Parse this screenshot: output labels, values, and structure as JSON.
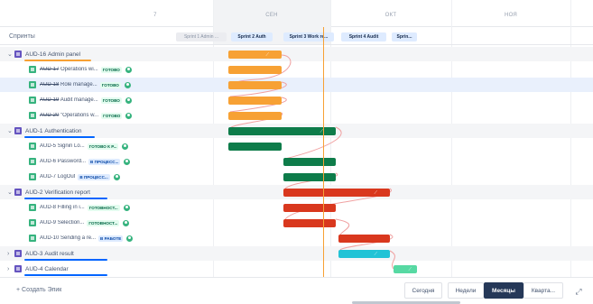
{
  "timeline": {
    "months": [
      "СЕН",
      "ОКТ",
      "НОЯ"
    ],
    "partial_label": "7",
    "sprints_label": "Спринты",
    "sprints": [
      {
        "label": "Sprint 1 Admin ...",
        "past": true
      },
      {
        "label": "Sprint 2 Auth",
        "past": false
      },
      {
        "label": "Sprint 3 Work re...",
        "past": false
      },
      {
        "label": "Sprint 4 Audit",
        "past": false
      },
      {
        "label": "Sprin...",
        "past": false
      }
    ]
  },
  "rows": [
    {
      "type": "epic",
      "key": "AUD-16",
      "title": "Admin panel",
      "expanded": true,
      "underline_color": "#f7a134"
    },
    {
      "type": "story",
      "key": "AUD-17",
      "title": "Operations wi...",
      "status": "ГОТОВО",
      "status_kind": "done",
      "struck": true
    },
    {
      "type": "story",
      "key": "AUD-18",
      "title": "Role manage...",
      "status": "ГОТОВО",
      "status_kind": "done",
      "struck": true,
      "selected": true
    },
    {
      "type": "story",
      "key": "AUD-19",
      "title": "Audit manage...",
      "status": "ГОТОВО",
      "status_kind": "done",
      "struck": true
    },
    {
      "type": "story",
      "key": "AUD-20",
      "title": "\"Operations w...",
      "status": "ГОТОВО",
      "status_kind": "done",
      "struck": true
    },
    {
      "type": "epic",
      "key": "AUD-1",
      "title": "Authentication",
      "expanded": true,
      "underline_color": "#0065ff"
    },
    {
      "type": "story",
      "key": "AUD-5",
      "title": "Signin Lo...",
      "status": "ГОТОВО К Р...",
      "status_kind": "done",
      "struck": false
    },
    {
      "type": "story",
      "key": "AUD-6",
      "title": "Password...",
      "status": "В ПРОЦЕСС...",
      "status_kind": "progress",
      "struck": false
    },
    {
      "type": "story",
      "key": "AUD-7",
      "title": "LogOut",
      "status": "В ПРОЦЕСС...",
      "status_kind": "progress",
      "struck": false
    },
    {
      "type": "epic",
      "key": "AUD-2",
      "title": "Verification report",
      "expanded": true,
      "underline_color": "#0065ff"
    },
    {
      "type": "story",
      "key": "AUD-8",
      "title": "Filling in i...",
      "status": "ГОТОВНОСТ...",
      "status_kind": "done",
      "struck": false
    },
    {
      "type": "story",
      "key": "AUD-9",
      "title": "Selection...",
      "status": "ГОТОВНОСТ...",
      "status_kind": "done",
      "struck": false
    },
    {
      "type": "story",
      "key": "AUD-10",
      "title": "Sending a re...",
      "status": "В РАБОТЕ",
      "status_kind": "progress",
      "struck": false
    },
    {
      "type": "epic",
      "key": "AUD-3",
      "title": "Audit result",
      "expanded": false,
      "underline_color": "#0065ff"
    },
    {
      "type": "epic",
      "key": "AUD-4",
      "title": "Calendar",
      "expanded": false,
      "underline_color": "#0065ff"
    }
  ],
  "colors": {
    "admin": "#f7a134",
    "auth": "#0e7c4a",
    "verification": "#d9381e",
    "audit": "#22c3d6",
    "calendar": "#57d9a3",
    "today": "#f7a134",
    "dependency": "#f0a0a0"
  },
  "footer": {
    "create_epic": "+ Создать Эпик",
    "today": "Сегодня",
    "weeks": "Недели",
    "months": "Месяцы",
    "quarters": "Кварта...",
    "active_view": "Месяцы"
  }
}
